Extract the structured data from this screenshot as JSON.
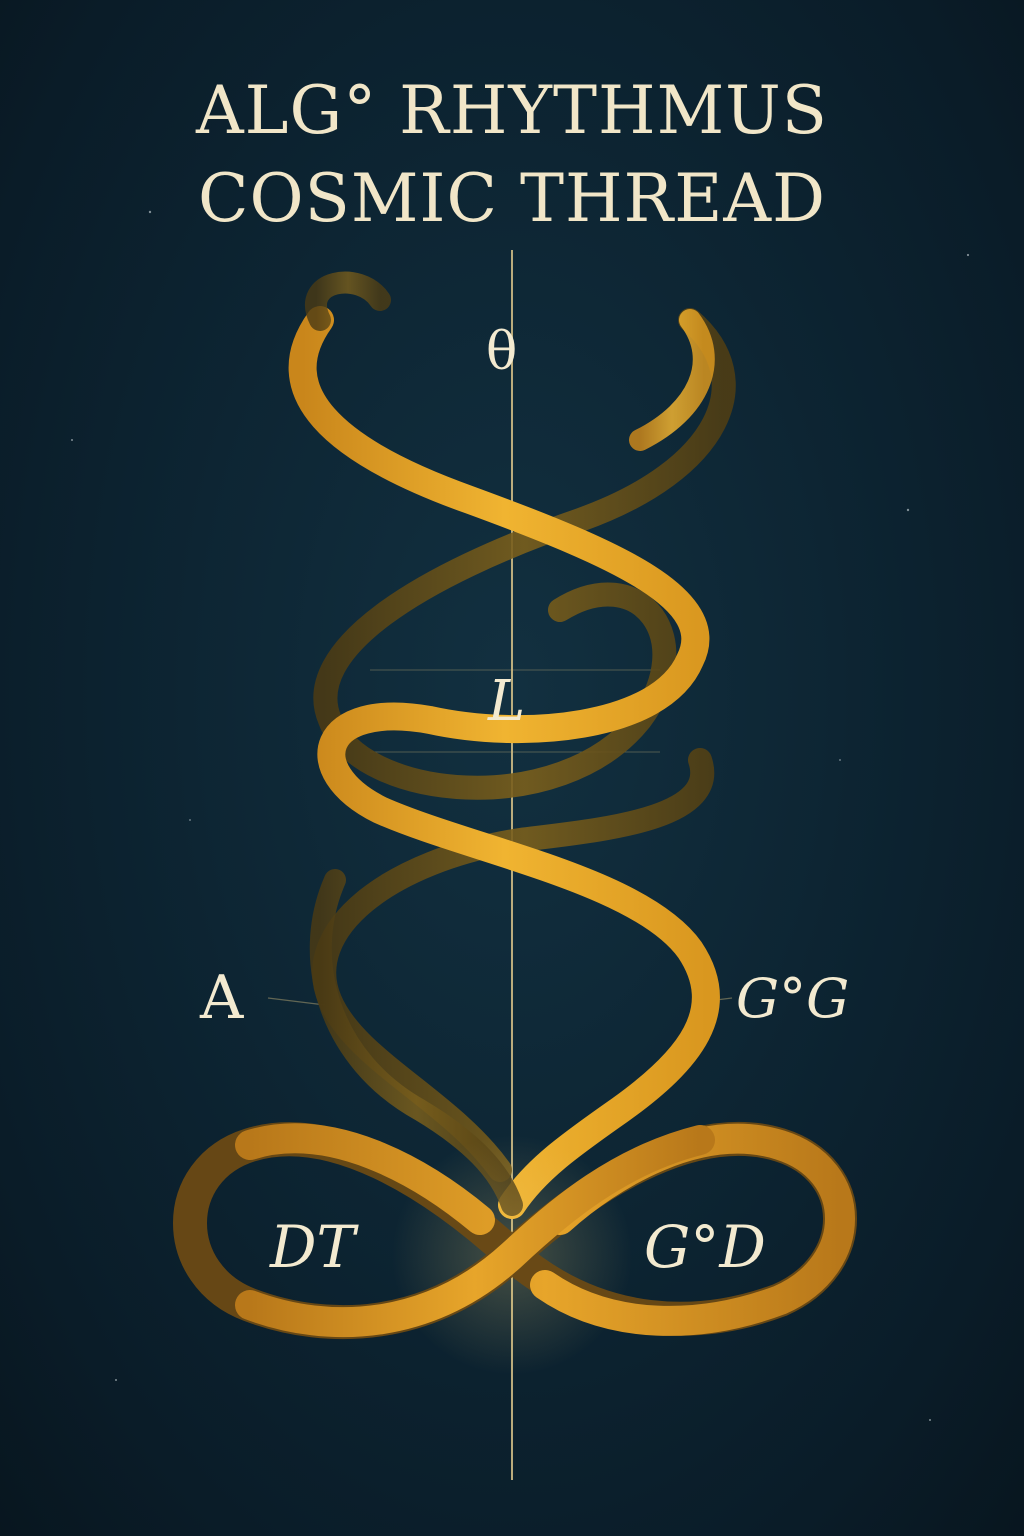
{
  "title": {
    "line1": "ALG° RHYTHMUS",
    "line2": "COSMIC THREAD"
  },
  "symbols": {
    "top": "θ",
    "middle": "L",
    "left": "A",
    "right": "G°G",
    "loop_left": "DT",
    "loop_right": "G°D"
  },
  "colors": {
    "background": "#0d2533",
    "ribbon_gold": "#e3a528",
    "ribbon_shadow": "#6b5418",
    "text": "#f1e6c8",
    "axis": "#d9c48a"
  }
}
